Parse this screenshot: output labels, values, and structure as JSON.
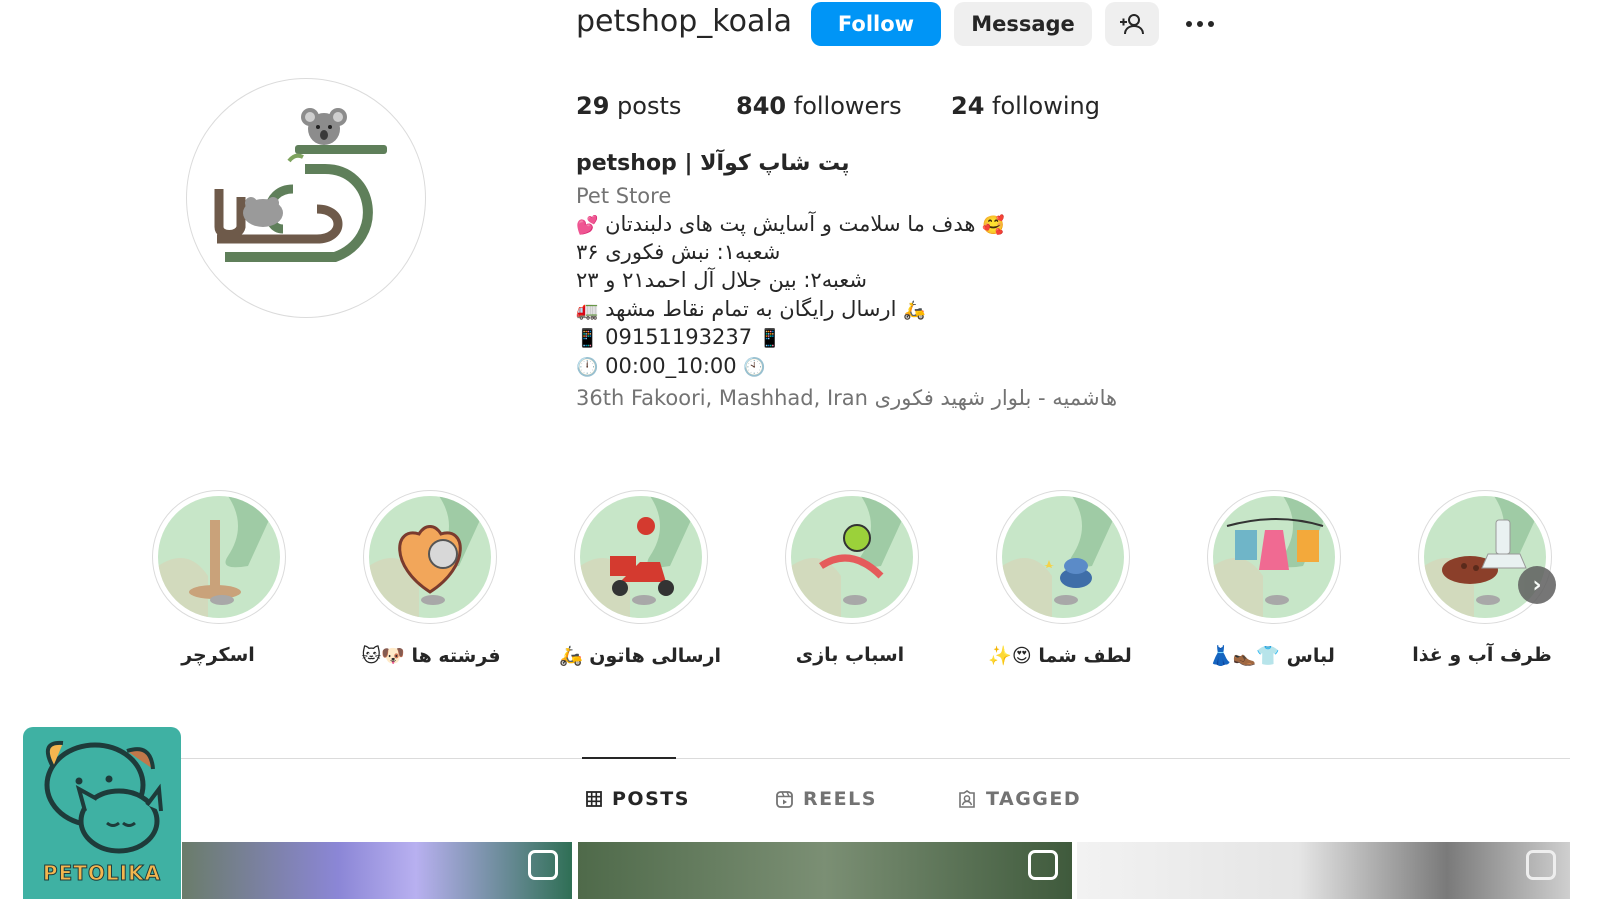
{
  "header": {
    "username": "petshop_koala",
    "follow_label": "Follow",
    "message_label": "Message"
  },
  "stats": {
    "posts_count": "29",
    "posts_label": "posts",
    "followers_count": "840",
    "followers_label": "followers",
    "following_count": "24",
    "following_label": "following"
  },
  "bio": {
    "name": "petshop | پت شاپ کوآلا",
    "category": "Pet Store",
    "line1": "هدف ما سلامت و آسایش پت های دلبندتان",
    "line1_emoji_right": "🥰",
    "line1_emoji_left": "💕",
    "line2": "شعبه۱: نبش فکوری ۳۶",
    "line3": "شعبه۲: بین جلال آل احمد۲۱ و ۲۳",
    "line4": "ارسال رایگان به تمام نقاط مشهد",
    "line4_emoji_right": "🛵",
    "line4_emoji_left": "🚛",
    "phone": "09151193237",
    "phone_emoji": "📱",
    "hours": "00:00_10:00",
    "hours_emoji_left": "🕛",
    "hours_emoji_right": "🕙",
    "address": "36th Fakoori, Mashhad, Iran هاشمیه - بلوار شهید فکوری"
  },
  "highlights": [
    {
      "label": "اسکرچر",
      "icon": "scratcher-icon"
    },
    {
      "label": "فرشته ها 🐶🐱",
      "icon": "pets-heart-icon"
    },
    {
      "label": "ارسالی هاتون 🛵",
      "icon": "delivery-scooter-icon"
    },
    {
      "label": "اسباب بازی",
      "icon": "rope-toy-icon"
    },
    {
      "label": "لطف شما 😍✨",
      "icon": "sparkle-icon"
    },
    {
      "label": "لباس 👕👞👗",
      "icon": "clothes-icon"
    },
    {
      "label": "ظرف آب و غذا",
      "icon": "food-bowl-icon"
    }
  ],
  "tabs": [
    {
      "label": "POSTS",
      "icon": "grid-icon",
      "active": true
    },
    {
      "label": "REELS",
      "icon": "reels-icon",
      "active": false
    },
    {
      "label": "TAGGED",
      "icon": "tagged-icon",
      "active": false
    }
  ],
  "watermark": {
    "text": "PETOLIKA"
  },
  "colors": {
    "accent": "#0095f6",
    "highlight_bg": "#c7e6c8",
    "logo_green": "#5f7f5a"
  }
}
